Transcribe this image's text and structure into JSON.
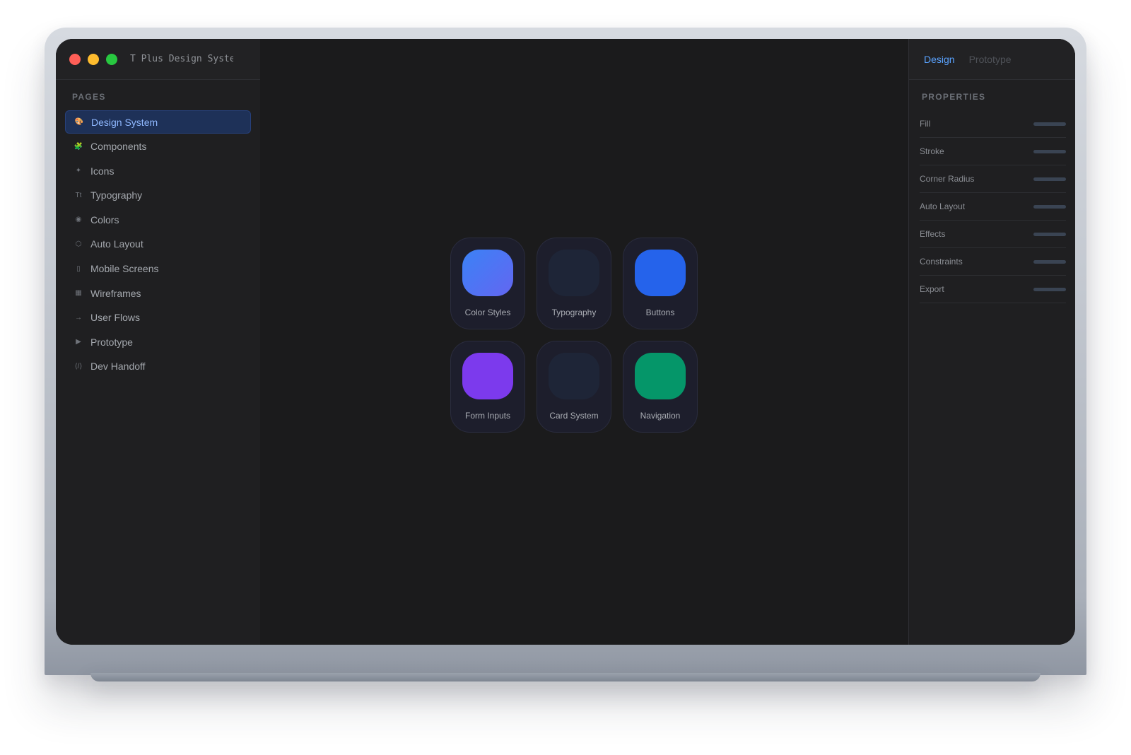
{
  "window": {
    "title": "T Plus Design Syste",
    "controls": [
      "close",
      "minimize",
      "maximize"
    ]
  },
  "sidebar": {
    "section_label": "PAGES",
    "items": [
      {
        "label": "Design System",
        "icon": "palette-icon",
        "glyph": "🎨",
        "active": true
      },
      {
        "label": "Components",
        "icon": "puzzle-icon",
        "glyph": "🧩",
        "active": false
      },
      {
        "label": "Icons",
        "icon": "sparkle-icon",
        "glyph": "✦",
        "active": false
      },
      {
        "label": "Typography",
        "icon": "type-icon",
        "glyph": "Tt",
        "active": false
      },
      {
        "label": "Colors",
        "icon": "circle-icon",
        "glyph": "◉",
        "active": false
      },
      {
        "label": "Auto Layout",
        "icon": "hexagon-icon",
        "glyph": "⬡",
        "active": false
      },
      {
        "label": "Mobile Screens",
        "icon": "mobile-icon",
        "glyph": "▯",
        "active": false
      },
      {
        "label": "Wireframes",
        "icon": "grid-icon",
        "glyph": "▦",
        "active": false
      },
      {
        "label": "User Flows",
        "icon": "arrow-icon",
        "glyph": "→",
        "active": false
      },
      {
        "label": "Prototype",
        "icon": "play-icon",
        "glyph": "▶",
        "active": false
      },
      {
        "label": "Dev Handoff",
        "icon": "code-icon",
        "glyph": "⟨/⟩",
        "active": false
      }
    ]
  },
  "canvas": {
    "tiles": [
      {
        "label": "Color Styles",
        "color": "linear-gradient(135deg, #3b82f6, #6366f1)"
      },
      {
        "label": "Typography",
        "color": "#1e2537"
      },
      {
        "label": "Buttons",
        "color": "#2563eb"
      },
      {
        "label": "Form Inputs",
        "color": "#7c3aed"
      },
      {
        "label": "Card System",
        "color": "#1e2537"
      },
      {
        "label": "Navigation",
        "color": "#059669"
      }
    ]
  },
  "panel": {
    "tabs": [
      {
        "label": "Design",
        "active": true
      },
      {
        "label": "Prototype",
        "active": false
      }
    ],
    "section_label": "PROPERTIES",
    "properties": [
      "Fill",
      "Stroke",
      "Corner Radius",
      "Auto Layout",
      "Effects",
      "Constraints",
      "Export"
    ]
  }
}
